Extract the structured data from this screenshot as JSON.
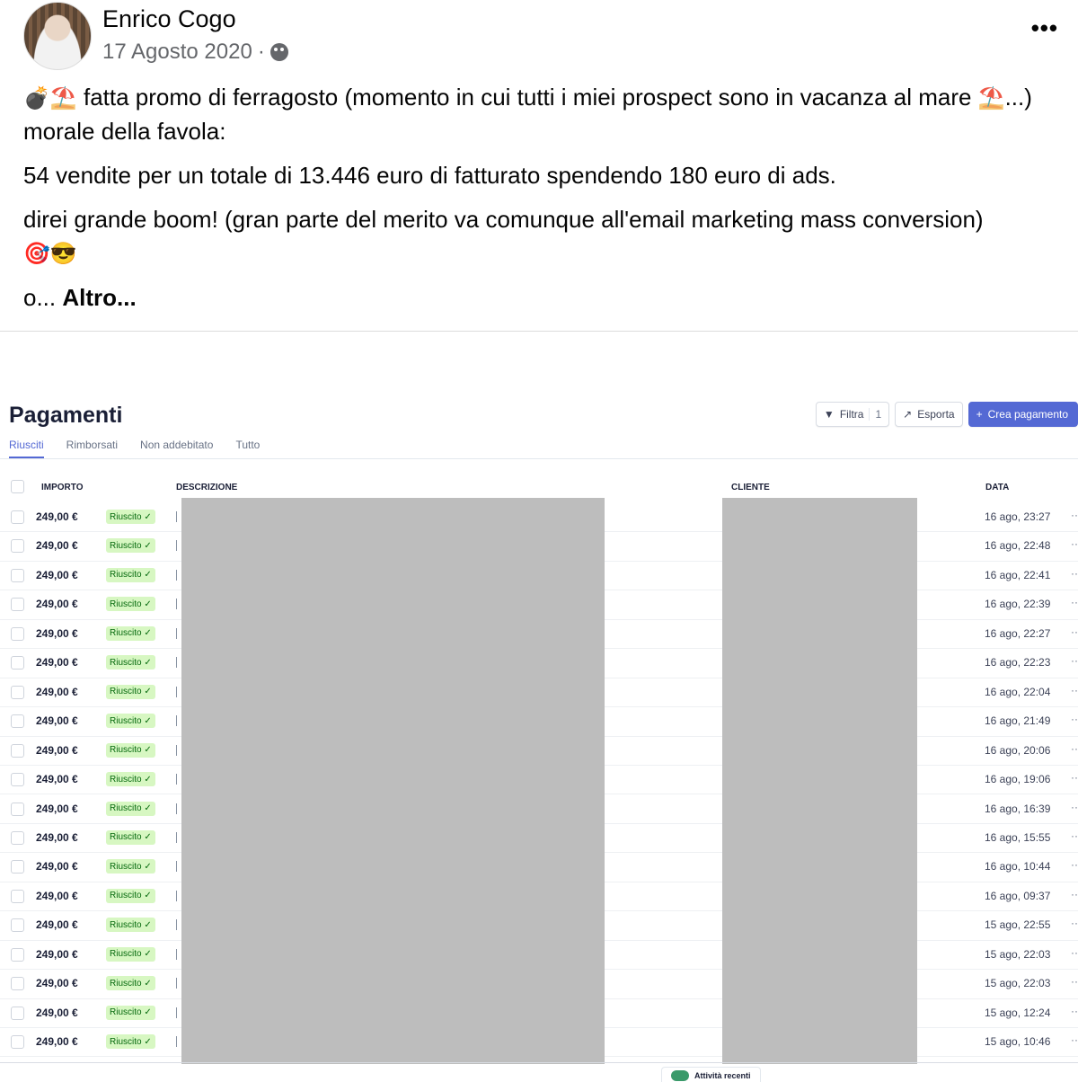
{
  "post": {
    "author": "Enrico Cogo",
    "date": "17 Agosto 2020",
    "separator": "·",
    "more_label": "•••",
    "line1_emoji": "💣⛱️",
    "line1_text": " fatta promo di ferragosto (momento in cui tutti i miei prospect sono in vacanza al mare ",
    "line1_emoji2": "⛱️",
    "line1_tail": "...) morale della favola:",
    "line2": "54 vendite per un totale di 13.446 euro di fatturato spendendo 180 euro di ads.",
    "line3": "direi grande boom! (gran parte del merito va comunque all'email marketing mass conversion)",
    "line3_emoji": "🎯😎",
    "line4_prefix": "o...",
    "altro": "Altro..."
  },
  "screenshot": {
    "title": "Pagamenti",
    "filter_label": "Filtra",
    "filter_count": "1",
    "export_label": "Esporta",
    "create_label": "Crea pagamento",
    "tabs": [
      "Riusciti",
      "Rimborsati",
      "Non addebitato",
      "Tutto"
    ],
    "columns": {
      "amount": "IMPORTO",
      "description": "DESCRIZIONE",
      "customer": "CLIENTE",
      "date": "DATA"
    },
    "status_label": "Riuscito ✓",
    "recent_label": "Attività recenti",
    "rows": [
      {
        "amount": "249,00 €",
        "date": "16 ago, 23:27"
      },
      {
        "amount": "249,00 €",
        "date": "16 ago, 22:48"
      },
      {
        "amount": "249,00 €",
        "date": "16 ago, 22:41"
      },
      {
        "amount": "249,00 €",
        "date": "16 ago, 22:39"
      },
      {
        "amount": "249,00 €",
        "date": "16 ago, 22:27"
      },
      {
        "amount": "249,00 €",
        "date": "16 ago, 22:23"
      },
      {
        "amount": "249,00 €",
        "date": "16 ago, 22:04"
      },
      {
        "amount": "249,00 €",
        "date": "16 ago, 21:49"
      },
      {
        "amount": "249,00 €",
        "date": "16 ago, 20:06"
      },
      {
        "amount": "249,00 €",
        "date": "16 ago, 19:06"
      },
      {
        "amount": "249,00 €",
        "date": "16 ago, 16:39"
      },
      {
        "amount": "249,00 €",
        "date": "16 ago, 15:55"
      },
      {
        "amount": "249,00 €",
        "date": "16 ago, 10:44"
      },
      {
        "amount": "249,00 €",
        "date": "16 ago, 09:37"
      },
      {
        "amount": "249,00 €",
        "date": "15 ago, 22:55"
      },
      {
        "amount": "249,00 €",
        "date": "15 ago, 22:03"
      },
      {
        "amount": "249,00 €",
        "date": "15 ago, 22:03"
      },
      {
        "amount": "249,00 €",
        "date": "15 ago, 12:24"
      },
      {
        "amount": "249,00 €",
        "date": "15 ago, 10:46"
      }
    ]
  }
}
